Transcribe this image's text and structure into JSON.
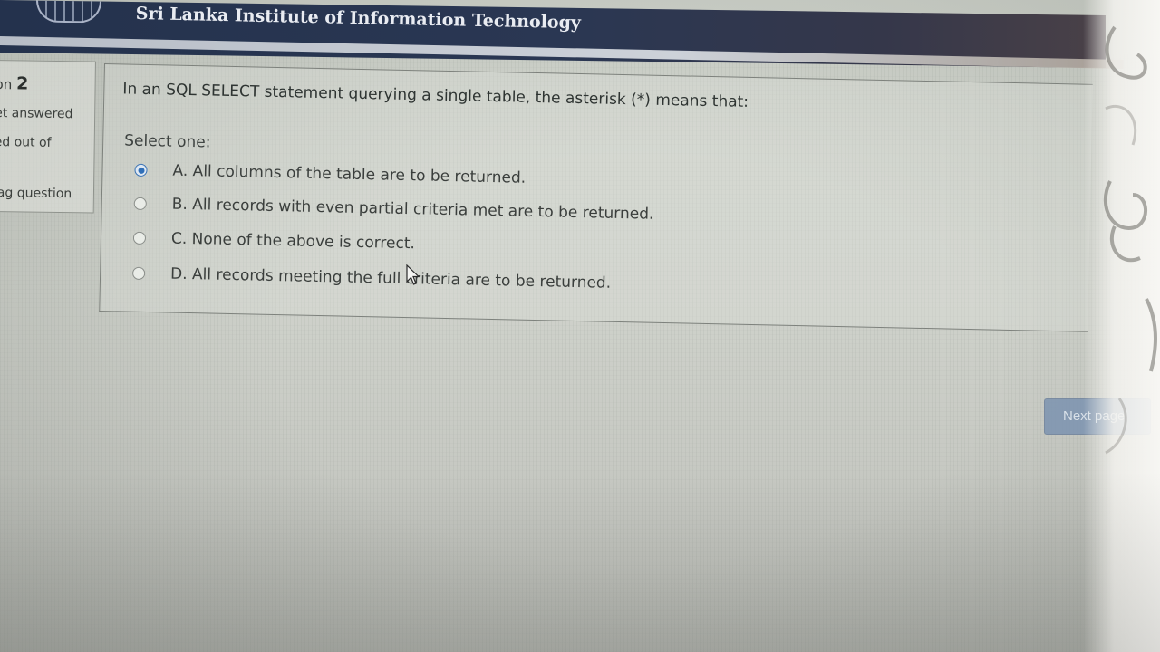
{
  "header": {
    "title": "Sri Lanka Institute of Information Technology"
  },
  "question_info": {
    "label": "on",
    "number": "2",
    "status": "et answered",
    "marked": "ed out of",
    "flag_label": "lag question"
  },
  "question": {
    "text": "In an SQL SELECT statement querying a single table, the asterisk (*) means that:",
    "prompt": "Select one:",
    "selected": "A",
    "options": [
      {
        "id": "A",
        "label": "A. All columns of the table are to be returned."
      },
      {
        "id": "B",
        "label": "B. All records with even partial criteria met are to be returned."
      },
      {
        "id": "C",
        "label": "C. None of the above is correct."
      },
      {
        "id": "D",
        "label": "D. All records meeting the full criteria are to be returned."
      }
    ]
  },
  "navigation": {
    "next_label": "Next page"
  },
  "colors": {
    "header_bg": "#24324d",
    "selected_radio": "#2f6fb8",
    "next_button": "#7c93b0"
  }
}
